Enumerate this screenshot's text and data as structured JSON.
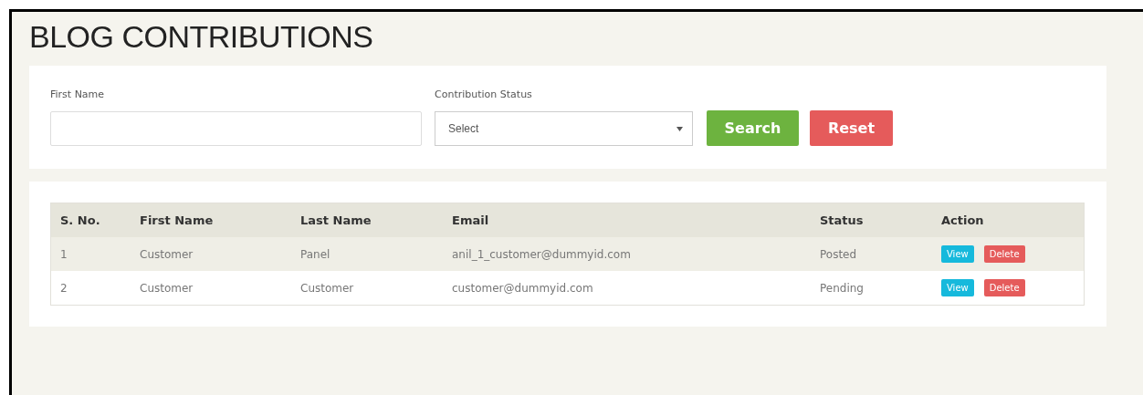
{
  "title": "BLOG CONTRIBUTIONS",
  "filters": {
    "first_name": {
      "label": "First Name"
    },
    "status": {
      "label": "Contribution Status",
      "value": "Select"
    },
    "buttons": [
      {
        "kind": "search",
        "label": "Search"
      },
      {
        "kind": "reset",
        "label": "Reset"
      }
    ]
  },
  "table": {
    "columns": [
      "S. No.",
      "First Name",
      "Last Name",
      "Email",
      "Status",
      "Action"
    ],
    "rows": [
      {
        "sno": "1",
        "first_name": "Customer",
        "last_name": "Panel",
        "email": "anil_1_customer@dummyid.com",
        "status": "Posted",
        "actions": [
          {
            "kind": "view",
            "label": "View"
          },
          {
            "kind": "delete",
            "label": "Delete"
          }
        ]
      },
      {
        "sno": "2",
        "first_name": "Customer",
        "last_name": "Customer",
        "email": "customer@dummyid.com",
        "status": "Pending",
        "actions": [
          {
            "kind": "view",
            "label": "View"
          },
          {
            "kind": "delete",
            "label": "Delete"
          }
        ]
      }
    ]
  }
}
